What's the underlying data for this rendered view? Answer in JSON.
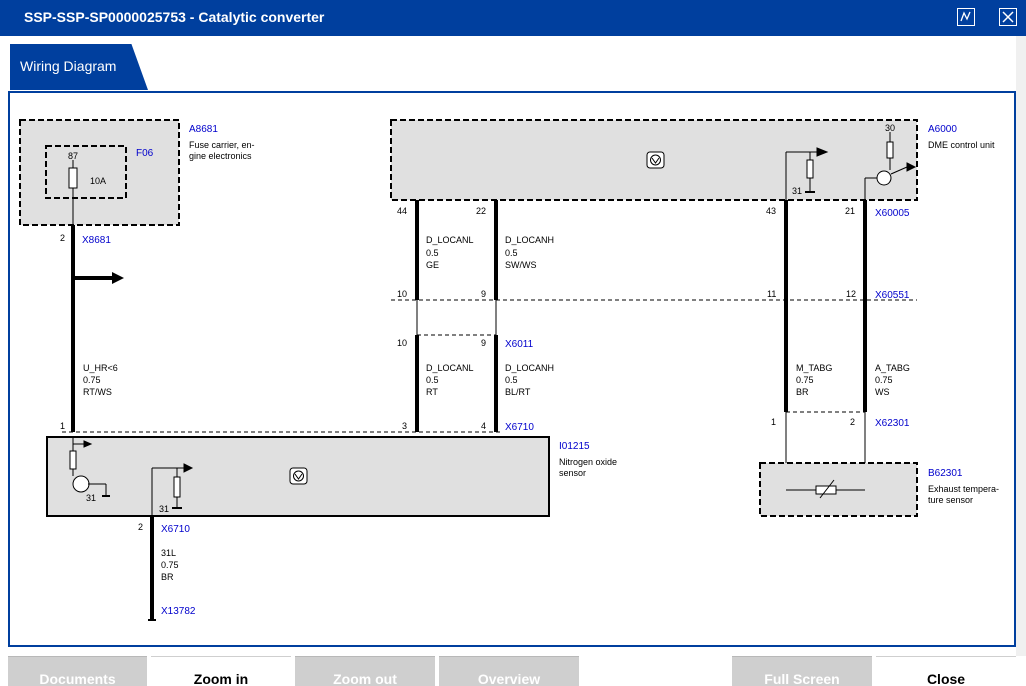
{
  "window": {
    "title": "SSP-SSP-SP0000025753  -  Catalytic converter"
  },
  "tabs": [
    {
      "label": "Wiring Diagram",
      "active": true
    }
  ],
  "colors": {
    "titlebar": "#003f9e",
    "component_fill": "#e0e0e0",
    "link": "#0000cc",
    "disabled_button": "#cfcfcf"
  },
  "components": {
    "a8681": {
      "id": "A8681",
      "desc1": "Fuse carrier, en-",
      "desc2": "gine electronics"
    },
    "f06": {
      "id": "F06",
      "pin": "87",
      "rating": "10A"
    },
    "a6000": {
      "id": "A6000",
      "desc": "DME control unit",
      "pin_top": "30",
      "ground": "31"
    },
    "i01215": {
      "id": "I01215",
      "desc1": "Nitrogen oxide",
      "desc2": "sensor",
      "ground1": "31",
      "ground2": "31"
    },
    "b62301": {
      "id": "B62301",
      "desc1": "Exhaust tempera-",
      "desc2": "ture sensor"
    }
  },
  "connectors": {
    "x8681": {
      "id": "X8681",
      "pin": "2"
    },
    "x60005": {
      "id": "X60005",
      "pins": [
        "44",
        "22",
        "43",
        "21"
      ]
    },
    "x60551": {
      "id": "X60551",
      "pins": [
        "10",
        "9",
        "11",
        "12"
      ]
    },
    "x6011": {
      "id": "X6011",
      "pins": [
        "10",
        "9"
      ]
    },
    "x6710_top": {
      "id": "X6710",
      "pins": [
        "1",
        "3",
        "4"
      ]
    },
    "x62301": {
      "id": "X62301",
      "pins": [
        "1",
        "2"
      ]
    },
    "x6710_bottom": {
      "id": "X6710",
      "pin": "2"
    },
    "x13782": {
      "id": "X13782"
    }
  },
  "wires": {
    "u_hr": {
      "name": "U_HR<6",
      "size": "0.75",
      "color": "RT/WS"
    },
    "d_locanl_1": {
      "name": "D_LOCANL",
      "size": "0.5",
      "color": "GE"
    },
    "d_locanh_1": {
      "name": "D_LOCANH",
      "size": "0.5",
      "color": "SW/WS"
    },
    "d_locanl_2": {
      "name": "D_LOCANL",
      "size": "0.5",
      "color": "RT"
    },
    "d_locanh_2": {
      "name": "D_LOCANH",
      "size": "0.5",
      "color": "BL/RT"
    },
    "m_tabg": {
      "name": "M_TABG",
      "size": "0.75",
      "color": "BR"
    },
    "a_tabg": {
      "name": "A_TABG",
      "size": "0.75",
      "color": "WS"
    },
    "w31l": {
      "name": "31L",
      "size": "0.75",
      "color": "BR"
    }
  },
  "buttons": {
    "documents": "Documents",
    "zoom_in": "Zoom in",
    "zoom_out": "Zoom out",
    "overview": "Overview",
    "full_screen": "Full Screen",
    "close": "Close"
  }
}
